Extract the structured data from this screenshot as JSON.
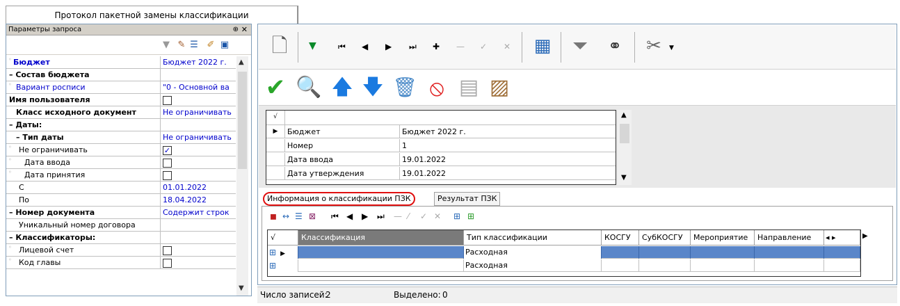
{
  "window": {
    "tab_title": "Протокол пакетной замены классификации"
  },
  "left_panel": {
    "title": "Параметры запроса",
    "rows": [
      {
        "key": "Бюджет",
        "value": "Бюджет 2022 г.",
        "style": "blue-bold",
        "dot": true
      },
      {
        "key": "– Состав бюджета",
        "value": "",
        "style": "bold"
      },
      {
        "key": "Вариант росписи",
        "value": "\"0 - Основной ва",
        "style": "blue-indent",
        "dot": true
      },
      {
        "key": "Имя пользователя",
        "value": "",
        "style": "bold",
        "dot": true,
        "checkbox": false
      },
      {
        "key": "Класс исходного документ",
        "value": "Не ограничивать",
        "style": "bold-indent"
      },
      {
        "key": "– Даты:",
        "value": "",
        "style": "bold"
      },
      {
        "key": "– Тип даты",
        "value": "Не ограничивать",
        "style": "bold-indent"
      },
      {
        "key": "Не ограничивать",
        "value": "",
        "style": "indent2",
        "dot": true,
        "checkbox": true
      },
      {
        "key": "Дата ввода",
        "value": "",
        "style": "indent3",
        "dot": true,
        "checkbox": false
      },
      {
        "key": "Дата принятия",
        "value": "",
        "style": "indent3",
        "dot": true,
        "checkbox": false
      },
      {
        "key": "С",
        "value": "01.01.2022",
        "style": "indent2"
      },
      {
        "key": "По",
        "value": "18.04.2022",
        "style": "indent2"
      },
      {
        "key": "– Номер документа",
        "value": "Содержит строк",
        "style": "bold"
      },
      {
        "key": "Уникальный номер договора",
        "value": "",
        "style": "indent2"
      },
      {
        "key": "– Классификаторы:",
        "value": "",
        "style": "bold"
      },
      {
        "key": "Лицевой счет",
        "value": "",
        "style": "indent2",
        "dot": true,
        "checkbox": false
      },
      {
        "key": "Код главы",
        "value": "",
        "style": "indent2",
        "dot": true,
        "checkbox": false
      }
    ]
  },
  "main_form": {
    "rows": [
      {
        "label": "Бюджет",
        "value": "Бюджет 2022 г."
      },
      {
        "label": "Номер",
        "value": "1"
      },
      {
        "label": "Дата ввода",
        "value": "19.01.2022"
      },
      {
        "label": "Дата утверждения",
        "value": "19.01.2022"
      }
    ]
  },
  "tabs": [
    "Информация о классификации ПЗК",
    "Результат ПЗК"
  ],
  "detail_grid": {
    "columns": [
      "Классификация",
      "Тип классификации",
      "КОСГУ",
      "СубКОСГУ",
      "Мероприятие",
      "Направление"
    ],
    "rows": [
      {
        "classification": "",
        "type": "Расходная"
      },
      {
        "classification": "",
        "type": "Расходная"
      }
    ]
  },
  "status": {
    "records_label": "Число записей:",
    "records_value": "2",
    "selected_label": "Выделено:",
    "selected_value": "0"
  },
  "colors": {
    "accent": "#0000cc",
    "selection": "#5a86c9",
    "tab_highlight": "#e01010"
  }
}
